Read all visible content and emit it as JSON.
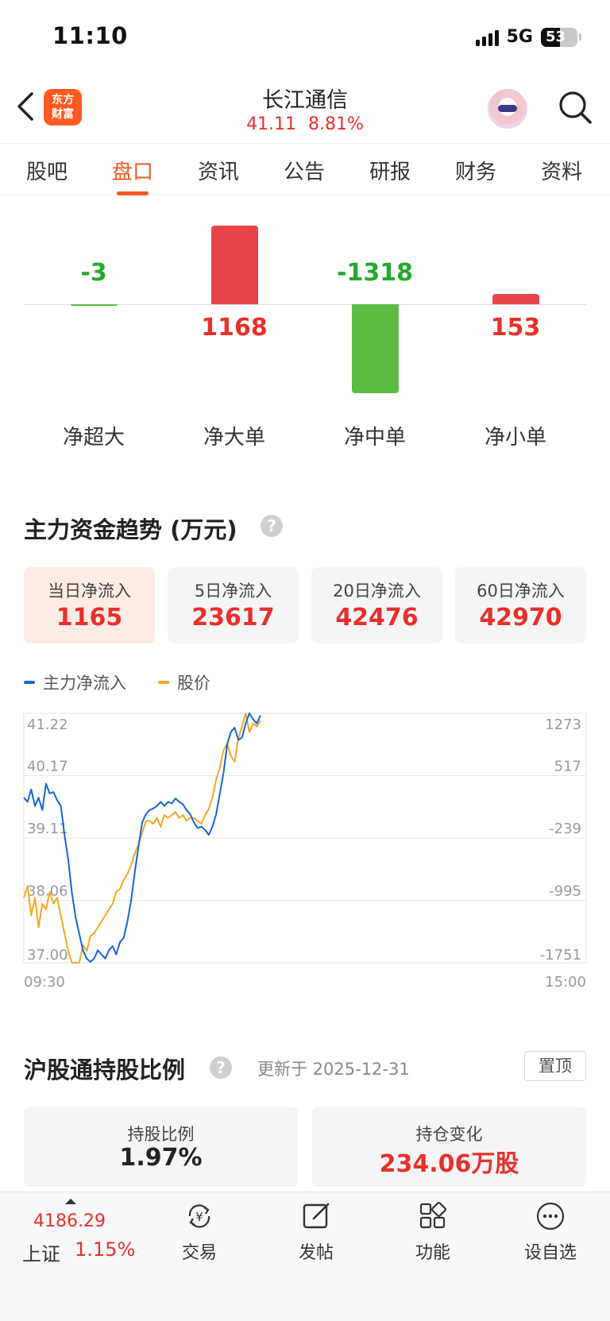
{
  "status_bar": {
    "time": "11:10",
    "network": "5G",
    "battery": "53",
    "battery_level": 0.53
  },
  "header": {
    "logo_line1": "东方",
    "logo_line2": "财富",
    "stock_name": "长江通信",
    "price": "41.11",
    "change_pct": "8.81%"
  },
  "tabs": [
    {
      "label": "股吧"
    },
    {
      "label": "盘口",
      "active": true
    },
    {
      "label": "资讯"
    },
    {
      "label": "公告"
    },
    {
      "label": "研报"
    },
    {
      "label": "财务"
    },
    {
      "label": "资料"
    }
  ],
  "fund_flow": {
    "items": [
      {
        "label": "净超大",
        "value": "-3",
        "amount": -3
      },
      {
        "label": "净大单",
        "value": "1168",
        "amount": 1168
      },
      {
        "label": "净中单",
        "value": "-1318",
        "amount": -1318
      },
      {
        "label": "净小单",
        "value": "153",
        "amount": 153
      }
    ],
    "colors": {
      "positive": "#e8454a",
      "negative": "#5bbb43"
    }
  },
  "trend": {
    "title": "主力资金趋势 (万元)",
    "cards": [
      {
        "label": "当日净流入",
        "value": "1165",
        "active": true
      },
      {
        "label": "5日净流入",
        "value": "23617"
      },
      {
        "label": "20日净流入",
        "value": "42476"
      },
      {
        "label": "60日净流入",
        "value": "42970"
      }
    ],
    "legend": [
      {
        "label": "主力净流入",
        "color": "#1565d8"
      },
      {
        "label": "股价",
        "color": "#f5a623"
      }
    ]
  },
  "chart_data": {
    "type": "line",
    "title": "",
    "x_start_label": "09:30",
    "x_end_label": "15:00",
    "left_axis": {
      "label": "",
      "ticks": [
        "41.22",
        "40.17",
        "39.11",
        "38.06",
        "37.00"
      ],
      "range": [
        37.0,
        41.22
      ]
    },
    "right_axis": {
      "label": "",
      "ticks": [
        "1273",
        "517",
        "-239",
        "-995",
        "-1751"
      ],
      "range": [
        -1751,
        1273
      ]
    },
    "grid": true,
    "legend_position": "top-left",
    "series": [
      {
        "name": "主力净流入",
        "axis": "right",
        "color": "#1565d8",
        "values": [
          250,
          200,
          350,
          150,
          250,
          100,
          420,
          300,
          320,
          220,
          150,
          -200,
          -500,
          -900,
          -1200,
          -1400,
          -1600,
          -1700,
          -1740,
          -1700,
          -1600,
          -1650,
          -1700,
          -1600,
          -1550,
          -1650,
          -1500,
          -1450,
          -1250,
          -1000,
          -650,
          -350,
          -50,
          50,
          100,
          120,
          150,
          200,
          150,
          200,
          180,
          240,
          200,
          170,
          100,
          50,
          -50,
          -120,
          -100,
          -140,
          -200,
          -100,
          50,
          300,
          550,
          900,
          1050,
          1100,
          950,
          980,
          1150,
          1273,
          1200,
          1150,
          1250
        ]
      },
      {
        "name": "股价",
        "axis": "left",
        "color": "#f5a623",
        "values": [
          38.1,
          38.3,
          37.8,
          38.1,
          37.6,
          38.0,
          37.9,
          38.2,
          38.0,
          38.1,
          37.8,
          37.5,
          37.2,
          37.0,
          36.95,
          37.0,
          37.3,
          37.2,
          37.45,
          37.5,
          37.6,
          37.7,
          37.8,
          37.9,
          38.0,
          38.2,
          38.25,
          38.4,
          38.5,
          38.65,
          38.85,
          39.0,
          39.2,
          39.4,
          39.4,
          39.35,
          39.45,
          39.3,
          39.5,
          39.45,
          39.5,
          39.55,
          39.45,
          39.5,
          39.4,
          39.45,
          39.45,
          39.4,
          39.35,
          39.5,
          39.6,
          39.8,
          40.1,
          40.3,
          40.6,
          40.7,
          40.5,
          40.4,
          40.8,
          41.0,
          41.22,
          40.9,
          41.05,
          41.0,
          41.1
        ]
      }
    ]
  },
  "hk_connect": {
    "title": "沪股通持股比例",
    "update_text": "更新于 2025-12-31",
    "pin_label": "置顶",
    "cards": [
      {
        "label": "持股比例",
        "value": "1.97%",
        "color": "#222222"
      },
      {
        "label": "持仓变化",
        "value": "234.06万股",
        "color": "#e8302b"
      }
    ]
  },
  "bottom_bar": {
    "index_value": "4186.29",
    "index_name": "上证",
    "index_change": "1.15%",
    "items": [
      {
        "label": "交易",
        "icon": "yen-cycle-icon"
      },
      {
        "label": "发帖",
        "icon": "edit-icon"
      },
      {
        "label": "功能",
        "icon": "grid-icon"
      },
      {
        "label": "设自选",
        "icon": "more-icon"
      }
    ]
  }
}
